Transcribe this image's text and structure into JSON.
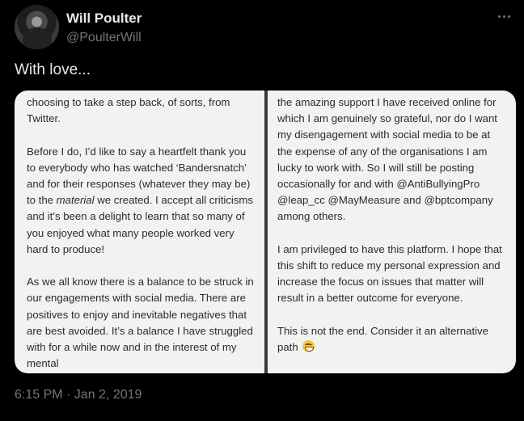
{
  "author": {
    "display_name": "Will Poulter",
    "handle": "@PoulterWill"
  },
  "tweet": {
    "text": "With love...",
    "timestamp": "6:15 PM · Jan 2, 2019"
  },
  "media": {
    "left_panel": {
      "p1": "choosing to take a step back, of sorts, from Twitter.",
      "p2_before": "Before I do, I’d like to say a heartfelt thank you to everybody who has watched ‘Bandersnatch’ and for their responses (whatever they may be) to the ",
      "p2_em": "material",
      "p2_after": " we created. I accept all criticisms and it’s been a delight to learn that so many of you enjoyed what many people worked very hard to produce!",
      "p3": "As we all know there is a balance to be struck in our engagements with social media. There are positives to enjoy and inevitable negatives that are best avoided. It’s a balance I have struggled with for a while now and in the interest of my mental"
    },
    "right_panel": {
      "p1": "the amazing support I have received online for which I am genuinely so grateful, nor do I want my disengagement with social media to be at the expense of any of the organisations I am lucky to work with. So I will still be posting occasionally for and with @AntiBullyingPro @leap_cc @MayMeasure and @bptcompany among others.",
      "p2": "I am privileged to have this platform. I hope that this shift to reduce my personal expression and increase the focus on issues that matter will result in a better outcome for everyone.",
      "p3": "This is not the end. Consider it an alternative path"
    },
    "emoji_icon": "grinning-face-emoji"
  },
  "icons": {
    "more": "more-dots-icon"
  }
}
